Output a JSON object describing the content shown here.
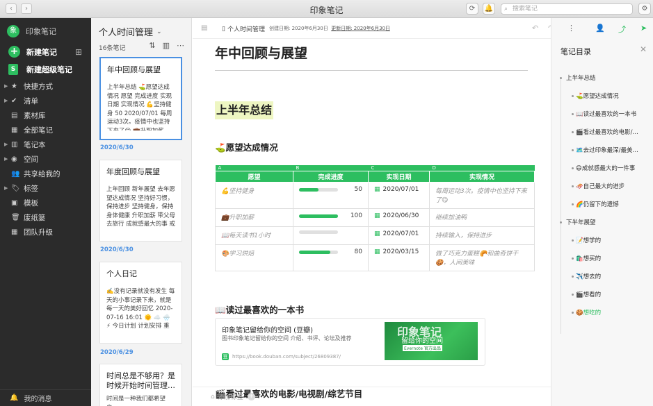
{
  "window": {
    "title": "印象笔记",
    "search_placeholder": "搜索笔记"
  },
  "sidebar": {
    "account": "印象笔记",
    "avatar_text": "象",
    "new_note": "新建笔记",
    "new_super_note": "新建超级笔记",
    "items": [
      {
        "label": "快捷方式",
        "icon": "star-icon",
        "glyph": "★",
        "caret": true
      },
      {
        "label": "清单",
        "icon": "check-icon",
        "glyph": "✔",
        "caret": true
      },
      {
        "label": "素材库",
        "icon": "library-icon",
        "glyph": "▤",
        "caret": false
      },
      {
        "label": "全部笔记",
        "icon": "notes-icon",
        "glyph": "▦",
        "caret": false
      },
      {
        "label": "笔记本",
        "icon": "notebook-icon",
        "glyph": "▥",
        "caret": true
      },
      {
        "label": "空间",
        "icon": "space-icon",
        "glyph": "◉",
        "caret": true
      },
      {
        "label": "共享给我的",
        "icon": "shared-icon",
        "glyph": "👥",
        "caret": false
      },
      {
        "label": "标签",
        "icon": "tag-icon",
        "glyph": "🏷",
        "caret": true
      },
      {
        "label": "模板",
        "icon": "template-icon",
        "glyph": "▣",
        "caret": false
      },
      {
        "label": "废纸篓",
        "icon": "trash-icon",
        "glyph": "🗑",
        "caret": false
      },
      {
        "label": "团队升级",
        "icon": "team-icon",
        "glyph": "▦",
        "caret": false
      }
    ],
    "footer": "我的消息"
  },
  "notelist": {
    "title": "个人时间管理",
    "count": "16条笔记",
    "cards": [
      {
        "title": "年中回顾与展望",
        "snippet": "上半年总结 ⛳愿望达成情况 愿望 完成进度 实现日期 实现情况 💪坚持健身 50 2020/07/01 每周运动3次。疫情中也坚持下来了😋 💼升职加薪 100 2020/06/30"
      },
      {
        "title": "年度回顾与展望",
        "snippet": "上年回顾 新年展望 去年愿望达成情况 坚持好习惯，保持进步 坚持健身，保持身体健康 升职加薪 带父母去旅行 成就感最大的事 戒掉坏习惯，更加优秀 自己..."
      },
      {
        "title": "个人日记",
        "snippet": "✍️没有记录就没有发生 每天的小事记录下来，就是每一天的美好回忆 2020-07-16 16:01 🌞 ☁️ 🌧️ ⚡ 今日计划 计划安排 重要等级 紧急程度 开始时间 计划用..."
      },
      {
        "title": "时间总是不够用？是时候开始时间管理…",
        "snippet": "时间是一种我们都希望自…"
      }
    ],
    "dates": [
      "2020/6/30",
      "2020/6/30",
      "2020/6/29"
    ]
  },
  "editor": {
    "breadcrumb": "个人时间管理",
    "created": "创建日期: 2020年6月30日",
    "updated": "更新日期: 2020年6月30日",
    "title": "年中回顾与展望",
    "h2": "上半年总结",
    "sec1": "⛳愿望达成情况",
    "table": {
      "letters": [
        "A",
        "B",
        "C",
        "D"
      ],
      "headers": [
        "愿望",
        "完成进度",
        "实现日期",
        "实现情况"
      ],
      "rows": [
        {
          "wish": "💪坚持健身",
          "progress": 50,
          "date": "2020/07/01",
          "detail": "每周运动3次。疫情中也坚持下来了😋"
        },
        {
          "wish": "💼升职加薪",
          "progress": 100,
          "date": "2020/06/30",
          "detail": "继续加油鸭"
        },
        {
          "wish": "📖每天读书1小时",
          "progress": 0,
          "date": "2020/07/01",
          "detail": "持续输入，保持进步"
        },
        {
          "wish": "🎨学习烘焙",
          "progress": 80,
          "date": "2020/03/15",
          "detail": "做了巧克力蛋糕🥐和曲奇饼干🍪，人间美味"
        }
      ]
    },
    "sec2": "📖读过最喜欢的一本书",
    "link": {
      "title": "印象笔记留给你的空间 (豆瓣)",
      "desc": "图书印象笔记留给你的空间 介绍、书评、论坛及推荐",
      "url": "https://book.douban.com/subject/26809387/",
      "cover_big": "印象笔记",
      "cover_sub": "留给你的空间",
      "cover_tag": "Evernote 官方出品"
    },
    "sec3": "🎬看过最喜欢的电影/电视剧/综艺节目",
    "add_tag": "添加标签"
  },
  "toc": {
    "title": "笔记目录",
    "items": [
      {
        "label": "上半年总结",
        "level": 1,
        "active": false
      },
      {
        "label": "⛳愿望达成情况",
        "level": 2,
        "active": false
      },
      {
        "label": "📖读过最喜欢的一本书",
        "level": 2,
        "active": false
      },
      {
        "label": "🎬看过最喜欢的电影/…",
        "level": 2,
        "active": false
      },
      {
        "label": "🗺️去过印象最深/最美…",
        "level": 2,
        "active": false
      },
      {
        "label": "😄成就感最大的一件事",
        "level": 2,
        "active": false
      },
      {
        "label": "🛷自己最大的进步",
        "level": 2,
        "active": false
      },
      {
        "label": "🌈仍留下的遗憾",
        "level": 2,
        "active": false
      },
      {
        "label": "下半年展望",
        "level": 1,
        "active": false
      },
      {
        "label": "📝想学的",
        "level": 2,
        "active": false
      },
      {
        "label": "🛍️想买的",
        "level": 2,
        "active": false
      },
      {
        "label": "✈️想去的",
        "level": 2,
        "active": false
      },
      {
        "label": "🎬想看的",
        "level": 2,
        "active": false
      },
      {
        "label": "🍪想吃的",
        "level": 2,
        "active": true
      }
    ]
  },
  "colors": {
    "accent": "#2dbe60",
    "sidebar": "#2b2b2b",
    "link": "#4a90e2"
  }
}
